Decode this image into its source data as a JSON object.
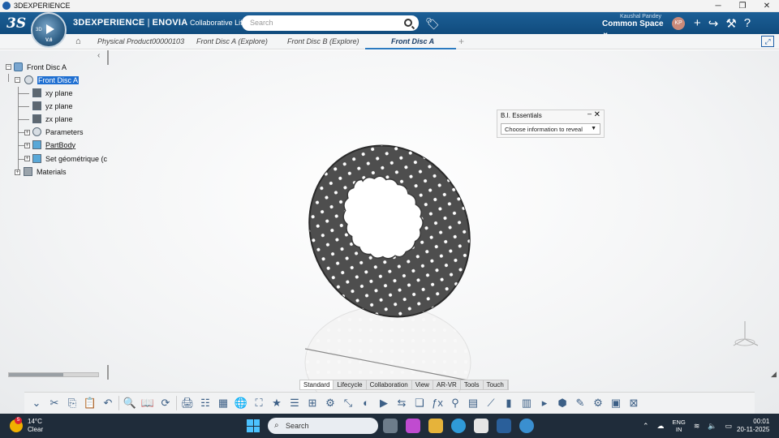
{
  "window": {
    "title": "3DEXPERIENCE",
    "controls": [
      "─",
      "❐",
      "✕"
    ]
  },
  "header": {
    "brand_main": "3DEXPERIENCE",
    "brand_sep": " | ",
    "brand_app": "ENOVIA",
    "brand_sub": " Collaborative Lifecycle",
    "compass_label": "3D",
    "compass_version": "V.6",
    "search_placeholder": "Search",
    "user_name": "Kaushal Pandey",
    "space": "Common Space ⌄",
    "avatar": "KP",
    "icons": [
      "+",
      "↪",
      "⚒",
      "?"
    ]
  },
  "tabs": [
    {
      "label": "Physical Product00000103",
      "active": false
    },
    {
      "label": "Front Disc A (Explore)",
      "active": false
    },
    {
      "label": "Front Disc B (Explore)",
      "active": false
    },
    {
      "label": "Front Disc A",
      "active": true
    }
  ],
  "tree": {
    "root": "Front Disc A",
    "part": "Front Disc A",
    "children": [
      "xy plane",
      "yz plane",
      "zx plane",
      "Parameters",
      "PartBody",
      "Set géométrique (c"
    ],
    "materials": "Materials"
  },
  "bi_panel": {
    "title": "B.I. Essentials",
    "select_value": "Choose information to reveal"
  },
  "bottom_tabs": [
    "Standard",
    "Lifecycle",
    "Collaboration",
    "View",
    "AR-VR",
    "Tools",
    "Touch"
  ],
  "active_bottom_tab": "Tools",
  "taskbar": {
    "temp": "14°C",
    "condition": "Clear",
    "badge": "5",
    "search": "Search",
    "lang1": "ENG",
    "lang2": "IN",
    "time": "00:01",
    "date": "20-11-2025"
  },
  "colors": {
    "header": "#155489",
    "selection": "#1f6fd1",
    "tab_underline": "#2b7ac0"
  }
}
